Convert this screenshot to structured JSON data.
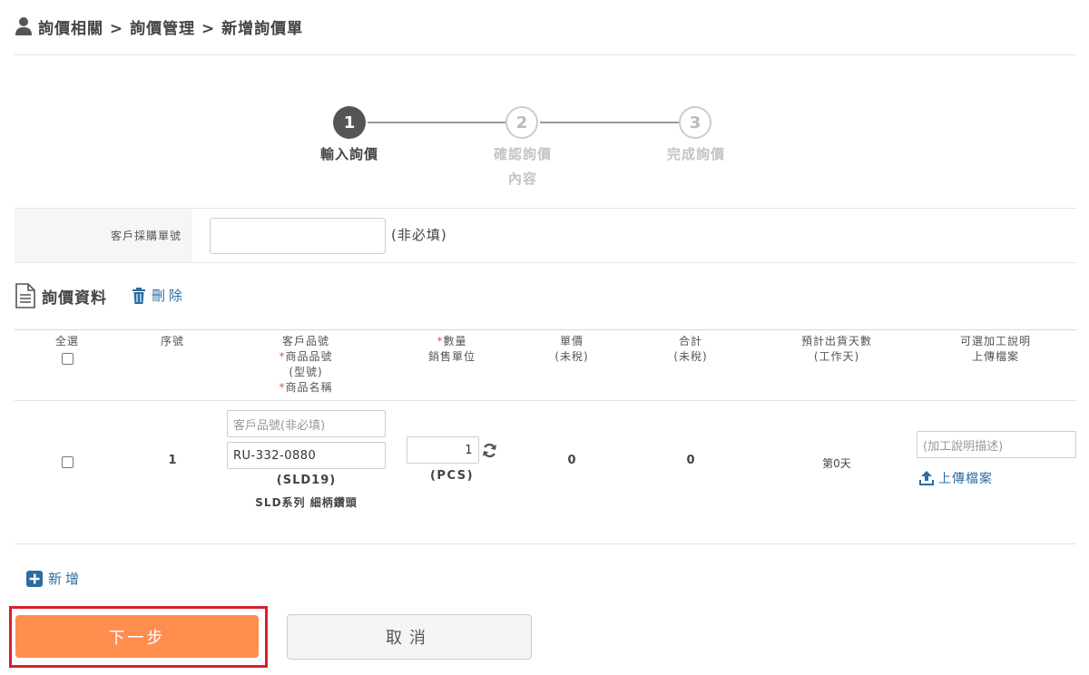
{
  "breadcrumb": {
    "text": "詢價相關 > 詢價管理 > 新增詢價單"
  },
  "stepper": {
    "steps": [
      {
        "number": "1",
        "label_line1": "輸入詢價",
        "label_line2": "",
        "state": "active"
      },
      {
        "number": "2",
        "label_line1": "確認詢價",
        "label_line2": "內容",
        "state": "inactive"
      },
      {
        "number": "3",
        "label_line1": "完成詢價",
        "label_line2": "",
        "state": "inactive"
      }
    ]
  },
  "po_field": {
    "label": "客戶採購單號",
    "value": "",
    "note": "(非必填)"
  },
  "section": {
    "title": "詢價資料",
    "delete_label": "刪除"
  },
  "table": {
    "headers": {
      "select_all": "全選",
      "seq": "序號",
      "customer_part": "客戶品號",
      "product_part_req": "*",
      "product_part": "商品品號",
      "model": "(型號)",
      "product_name_req": "*",
      "product_name": "商品名稱",
      "qty_req": "*",
      "qty": "數量",
      "sales_unit": "銷售單位",
      "unit_price": "單價",
      "unit_price_note": "(未稅)",
      "total": "合計",
      "total_note": "(未稅)",
      "ship_days": "預計出貨天數",
      "ship_days_note": "(工作天)",
      "processing": "可選加工說明",
      "upload": "上傳檔案"
    },
    "rows": [
      {
        "checked": false,
        "seq": "1",
        "customer_part_placeholder": "客戶品號(非必填)",
        "customer_part_value": "",
        "product_part": "RU-332-0880",
        "model": "(SLD19)",
        "product_name": "SLD系列 細柄鑽頭",
        "qty": "1",
        "unit": "(PCS)",
        "unit_price": "0",
        "total": "0",
        "ship_days": "第0天",
        "processing_placeholder": "(加工說明描述)",
        "upload_label": "上傳檔案"
      }
    ]
  },
  "add_label": "新增",
  "buttons": {
    "next": "下一步",
    "cancel": "取消"
  },
  "colors": {
    "accent_orange": "#ff8d4e",
    "link_blue": "#2d6ca2",
    "required_red": "#e0603a",
    "highlight_red": "#d7202a"
  }
}
